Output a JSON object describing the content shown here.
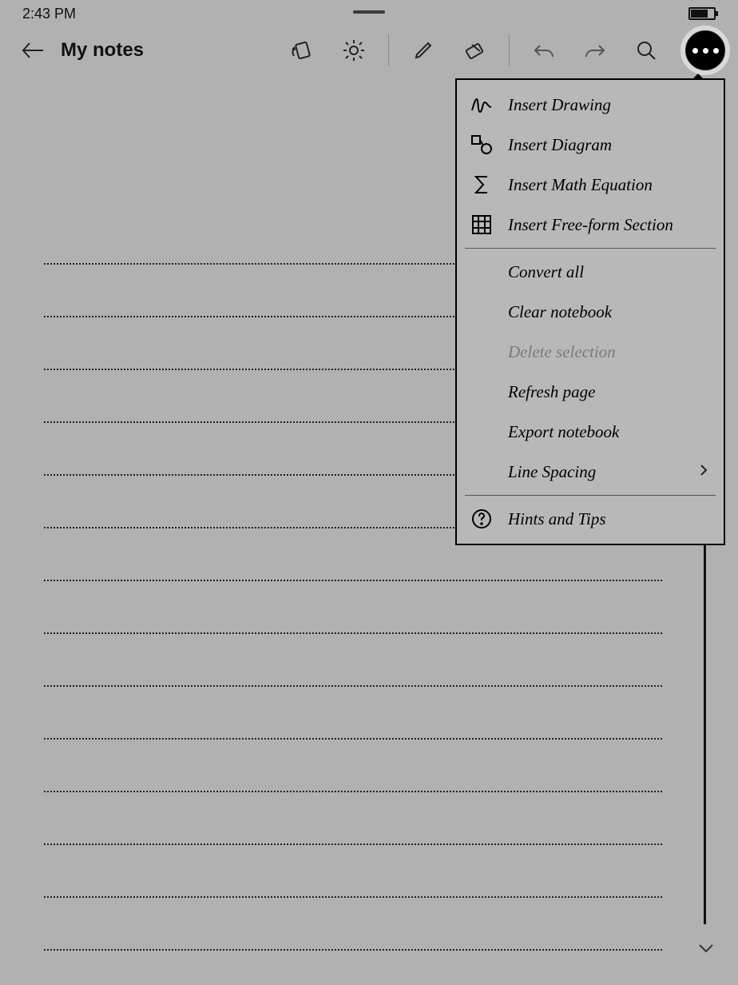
{
  "status": {
    "time": "2:43 PM"
  },
  "header": {
    "title": "My notes"
  },
  "menu": {
    "insert_drawing": "Insert Drawing",
    "insert_diagram": "Insert Diagram",
    "insert_math": "Insert Math Equation",
    "insert_freeform": "Insert Free-form Section",
    "convert_all": "Convert all",
    "clear_notebook": "Clear notebook",
    "delete_selection": "Delete selection",
    "refresh_page": "Refresh page",
    "export_notebook": "Export notebook",
    "line_spacing": "Line Spacing",
    "hints_tips": "Hints and Tips"
  }
}
